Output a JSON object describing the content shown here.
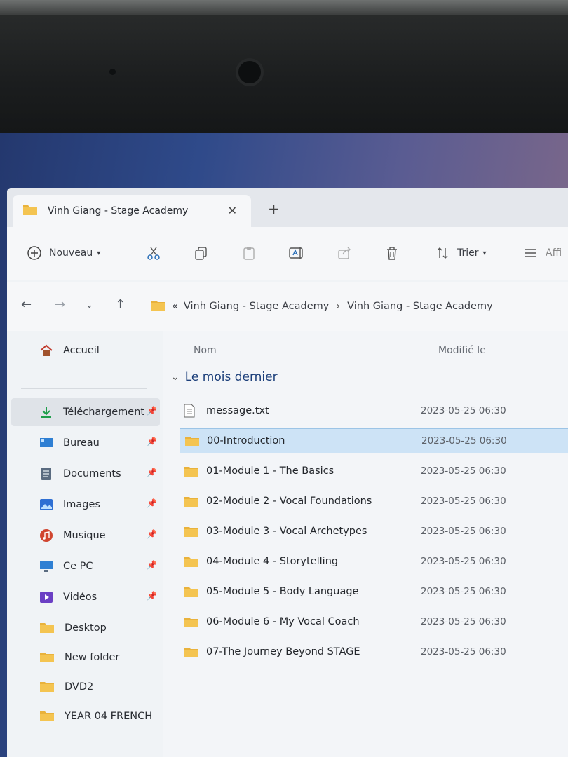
{
  "window": {
    "tab_title": "Vinh Giang - Stage Academy",
    "new_tab_symbol": "+",
    "close_symbol": "✕"
  },
  "toolbar": {
    "new_label": "Nouveau",
    "sort_label": "Trier",
    "view_label": "Affi"
  },
  "breadcrumb": {
    "overflow": "«",
    "items": [
      "Vinh Giang - Stage Academy",
      "Vinh Giang - Stage Academy"
    ],
    "separator": "›"
  },
  "sidebar": {
    "home": "Accueil",
    "pinned": [
      {
        "label": "Téléchargement",
        "icon": "download-icon"
      },
      {
        "label": "Bureau",
        "icon": "desktop-icon"
      },
      {
        "label": "Documents",
        "icon": "documents-icon"
      },
      {
        "label": "Images",
        "icon": "images-icon"
      },
      {
        "label": "Musique",
        "icon": "music-icon"
      },
      {
        "label": "Ce PC",
        "icon": "pc-icon"
      },
      {
        "label": "Vidéos",
        "icon": "videos-icon"
      }
    ],
    "folders": [
      {
        "label": "Desktop"
      },
      {
        "label": "New folder"
      },
      {
        "label": "DVD2"
      },
      {
        "label": "YEAR 04 FRENCH"
      }
    ]
  },
  "columns": {
    "name": "Nom",
    "modified": "Modifié le"
  },
  "group": {
    "label": "Le mois dernier"
  },
  "files": [
    {
      "name": "message.txt",
      "date": "2023-05-25 06:30",
      "type": "text-file-icon"
    },
    {
      "name": "00-Introduction",
      "date": "2023-05-25 06:30",
      "type": "folder-icon",
      "selected": true
    },
    {
      "name": "01-Module 1 - The Basics",
      "date": "2023-05-25 06:30",
      "type": "folder-icon"
    },
    {
      "name": "02-Module 2 - Vocal Foundations",
      "date": "2023-05-25 06:30",
      "type": "folder-icon"
    },
    {
      "name": "03-Module 3 - Vocal Archetypes",
      "date": "2023-05-25 06:30",
      "type": "folder-icon"
    },
    {
      "name": "04-Module 4 - Storytelling",
      "date": "2023-05-25 06:30",
      "type": "folder-icon"
    },
    {
      "name": "05-Module 5 - Body Language",
      "date": "2023-05-25 06:30",
      "type": "folder-icon"
    },
    {
      "name": "06-Module 6 - My Vocal Coach",
      "date": "2023-05-25 06:30",
      "type": "folder-icon"
    },
    {
      "name": "07-The Journey Beyond STAGE",
      "date": "2023-05-25 06:30",
      "type": "folder-icon"
    }
  ],
  "colors": {
    "folder": "#e9b23c",
    "selection": "#cde3f6",
    "accent": "#1c3f7a"
  }
}
